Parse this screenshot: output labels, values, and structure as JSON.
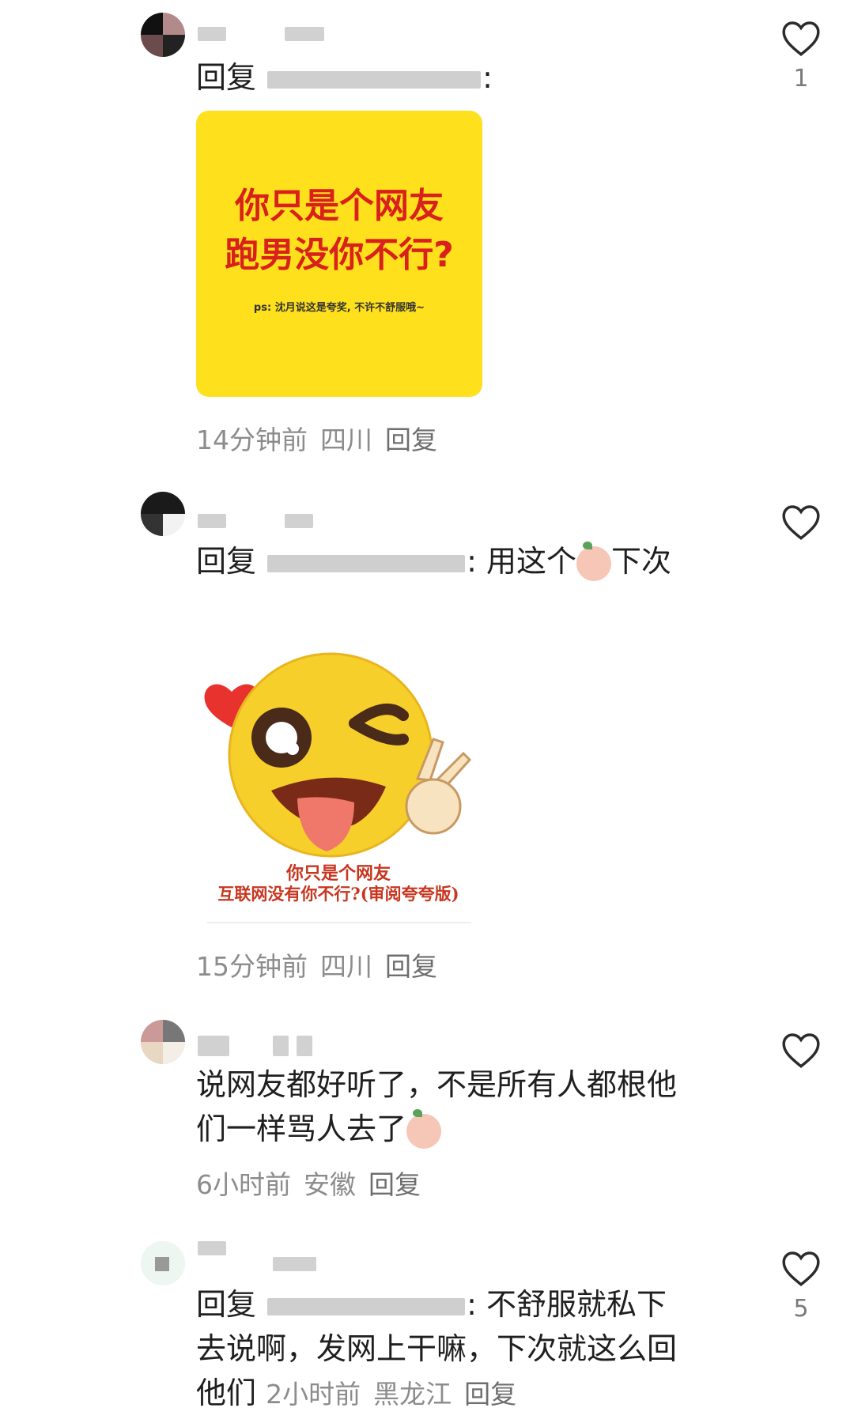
{
  "comments": [
    {
      "reply_prefix": "回复",
      "reply_tail": ":",
      "text": "",
      "image": {
        "line1": "你只是个网友",
        "line2": "跑男没你不行?",
        "ps": "ps: 沈月说这是夸奖, 不许不舒服哦~"
      },
      "time": "14分钟前",
      "region": "四川",
      "reply_label": "回复",
      "likes": "1"
    },
    {
      "reply_prefix": "回复",
      "reply_tail": ":",
      "text": "用这个",
      "text_after_emoji": "下次",
      "sticker": {
        "caption1": "你只是个网友",
        "caption2": "互联网没有你不行?(审阅夸夸版)"
      },
      "time": "15分钟前",
      "region": "四川",
      "reply_label": "回复",
      "likes": ""
    },
    {
      "text_line1": "说网友都好听了，不是所有人都根他",
      "text_line2": "们一样骂人去了",
      "time": "6小时前",
      "region": "安徽",
      "reply_label": "回复",
      "likes": ""
    },
    {
      "reply_prefix": "回复",
      "reply_tail": ":",
      "text_line1": "不舒服就私下",
      "text_line2": "去说啊，发网上干嘛，下次就这么回",
      "text_line3": "他们",
      "time": "2小时前",
      "region": "黑龙江",
      "reply_label": "回复",
      "likes": "5"
    }
  ],
  "icons": {
    "like": "heart-outline-icon"
  },
  "colors": {
    "card_yellow": "#ffe01c",
    "card_red": "#d8201c",
    "meta_grey": "#8c8c8c"
  }
}
